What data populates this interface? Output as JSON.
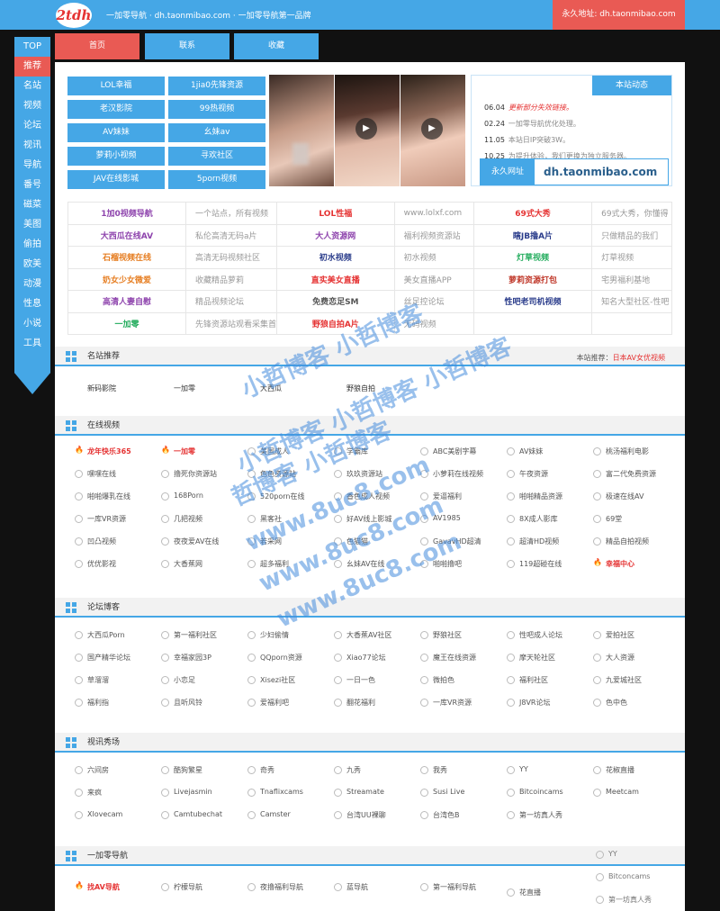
{
  "header": {
    "logo": "2tdh",
    "tagline": "一加零导航 · dh.taonmibao.com · 一加零导航第一品牌",
    "perm_link": "永久地址: dh.taonmibao.com"
  },
  "sidebar": [
    "TOP",
    "推荐",
    "名站",
    "视频",
    "论坛",
    "视讯",
    "导航",
    "番号",
    "磁菜",
    "美图",
    "偷拍",
    "欧美",
    "动漫",
    "性息",
    "小说",
    "工具"
  ],
  "tabs": [
    "首页",
    "联系",
    "收藏"
  ],
  "top_buttons": [
    "LOL幸福",
    "1jia0先锋资源",
    "老汉影院",
    "99热视频",
    "AV妹妹",
    "幺妹av",
    "萝莉小视频",
    "寻欢社区",
    "JAV在线影城",
    "5porn视频"
  ],
  "notice": {
    "title": "本站动态",
    "lines": [
      {
        "date": "06.04",
        "text": "更新部分失效链接。",
        "hot": true
      },
      {
        "date": "02.24",
        "text": "一加零导航优化处理。",
        "hot": false
      },
      {
        "date": "11.05",
        "text": "本站日IP突破3W。",
        "hot": false
      },
      {
        "date": "10.25",
        "text": "为提升体验，我们更换为独立服务器。",
        "hot": false
      }
    ],
    "domain_label": "永久网址",
    "domain": "dh.taonmibao.com"
  },
  "featured": [
    [
      {
        "n": "1加0视频导航",
        "d": "一个站点，所有视频",
        "c": "#8e44ad"
      },
      {
        "n": "LOL性福",
        "d": "www.lolxf.com",
        "c": "#e53333"
      },
      {
        "n": "69式大秀",
        "d": "69式大秀，你懂得",
        "c": "#e53333"
      }
    ],
    [
      {
        "n": "大西瓜在线AV",
        "d": "私伦高清无码a片",
        "c": "#8e44ad"
      },
      {
        "n": "大人资源网",
        "d": "福利视频资源站",
        "c": "#8e44ad"
      },
      {
        "n": "瞎JB撸A片",
        "d": "只做精品的我们",
        "c": "#2c3e8c"
      }
    ],
    [
      {
        "n": "石榴视频在线",
        "d": "高清无码视频社区",
        "c": "#e67e22"
      },
      {
        "n": "初水视频",
        "d": "初水视频",
        "c": "#2c3e8c"
      },
      {
        "n": "灯草视频",
        "d": "灯草视频",
        "c": "#27ae60"
      }
    ],
    [
      {
        "n": "奶女少女微爱",
        "d": "收藏精品萝莉",
        "c": "#e67e22"
      },
      {
        "n": "直实美女直播",
        "d": "美女直播APP",
        "c": "#e53333"
      },
      {
        "n": "萝莉资源打包",
        "d": "宅男福利基地",
        "c": "#c0392b"
      }
    ],
    [
      {
        "n": "高清人妻自慰",
        "d": "精品视频论坛",
        "c": "#8e44ad"
      },
      {
        "n": "免费恋足SM",
        "d": "丝足控论坛",
        "c": "#555555"
      },
      {
        "n": "性吧老司机视频",
        "d": "知名大型社区-性吧",
        "c": "#2c3e8c"
      }
    ],
    [
      {
        "n": "一加零",
        "d": "先锋资源站观看采集首",
        "c": "#27ae60"
      },
      {
        "n": "野狼自拍A片",
        "d": "无码视频",
        "c": "#e53333"
      },
      {
        "n": "",
        "d": "",
        "c": "#555555"
      }
    ]
  ],
  "sec_sites": {
    "title": "名站推荐",
    "note": "本站推荐：",
    "note_link": "日本AV女优视频",
    "items": [
      "新码影院",
      "一加零",
      "大西瓜",
      "野狼自拍"
    ]
  },
  "sec_video": {
    "title": "在线视频",
    "rows": [
      [
        "龙年快乐365",
        "一加零",
        "美国成人",
        "学霸库",
        "ABC美剧字幕",
        "AV妹妹",
        "桃汤福利电影"
      ],
      [
        "嘿嘿在线",
        "撸死你资源站",
        "色色资源站",
        "玖玖资源站",
        "小萝莉在线视频",
        "午夜资源",
        "富二代免费资源"
      ],
      [
        "啪啪爆乳在线",
        "168Porn",
        "520porn在线",
        "香色成人视频",
        "爱逼福利",
        "啪啪精品资源",
        "极速在线AV"
      ],
      [
        "一库VR资源",
        "几把视频",
        "黑客社",
        "好AV线上影城",
        "AV1985",
        "8X成人影库",
        "69堂"
      ],
      [
        "凹凸视频",
        "夜夜爱AV在线",
        "若采网",
        "色猫猫",
        "GavavHD超清",
        "超清HD视频",
        "精品自拍视频"
      ],
      [
        "优优影视",
        "大香蕉网",
        "超多福利",
        "幺妹AV在线",
        "啪啪撸吧",
        "119超碰在线",
        "幸福中心"
      ]
    ],
    "fire": [
      [
        0,
        0
      ],
      [
        0,
        1
      ],
      [
        5,
        6
      ]
    ]
  },
  "sec_forum": {
    "title": "论坛博客",
    "rows": [
      [
        "大西瓜Porn",
        "第一福利社区",
        "少妇偷情",
        "大香蕉AV社区",
        "野狼社区",
        "性吧成人论坛",
        "爱拍社区"
      ],
      [
        "国产精华论坛",
        "幸福家园3P",
        "QQporn资源",
        "Xiao77论坛",
        "魔王在线资源",
        "摩天轮社区",
        "大人资源"
      ],
      [
        "草溜溜",
        "小恋足",
        "Xisezi社区",
        "一日一色",
        "微拍色",
        "福利社区",
        "九爱城社区"
      ],
      [
        "福利指",
        "且听风铃",
        "爱福利吧",
        "翻花福利",
        "一库VR资源",
        "J8VR论坛",
        "色中色"
      ]
    ]
  },
  "sec_live": {
    "title": "视讯秀场",
    "rows": [
      [
        "六间房",
        "酷狗繁星",
        "奇秀",
        "九秀",
        "我秀",
        "YY",
        "花椒直播"
      ],
      [
        "来疯",
        "Livejasmin",
        "Tnaflixcams",
        "Streamate",
        "Susi Live",
        "Bitcoincams",
        "Meetcam"
      ],
      [
        "Xlovecam",
        "Camtubechat",
        "Camster",
        "台湾UU裸聊",
        "台湾色B",
        "第一坊真人秀",
        ""
      ]
    ]
  },
  "sec_nav": {
    "title": "一加零导航",
    "row": [
      "找AV导航",
      "柠檬导航",
      "夜撸福利导航",
      "蓝导航",
      "第一福利导航",
      "花直播",
      ""
    ]
  },
  "overflow_list": [
    "YY",
    "Bitconcams",
    "第一坊真人秀"
  ],
  "watermark": {
    "lines": [
      "小哲博客 小哲博客",
      "小哲博客 小哲博客 小哲博客",
      "哲博客 小哲博客",
      "www.8uc8.com",
      "www.8uc8.com",
      "www.8uc8.com"
    ]
  },
  "colors": {
    "accent": "#45a7e6",
    "red": "#e95a54",
    "background": "#111111"
  }
}
